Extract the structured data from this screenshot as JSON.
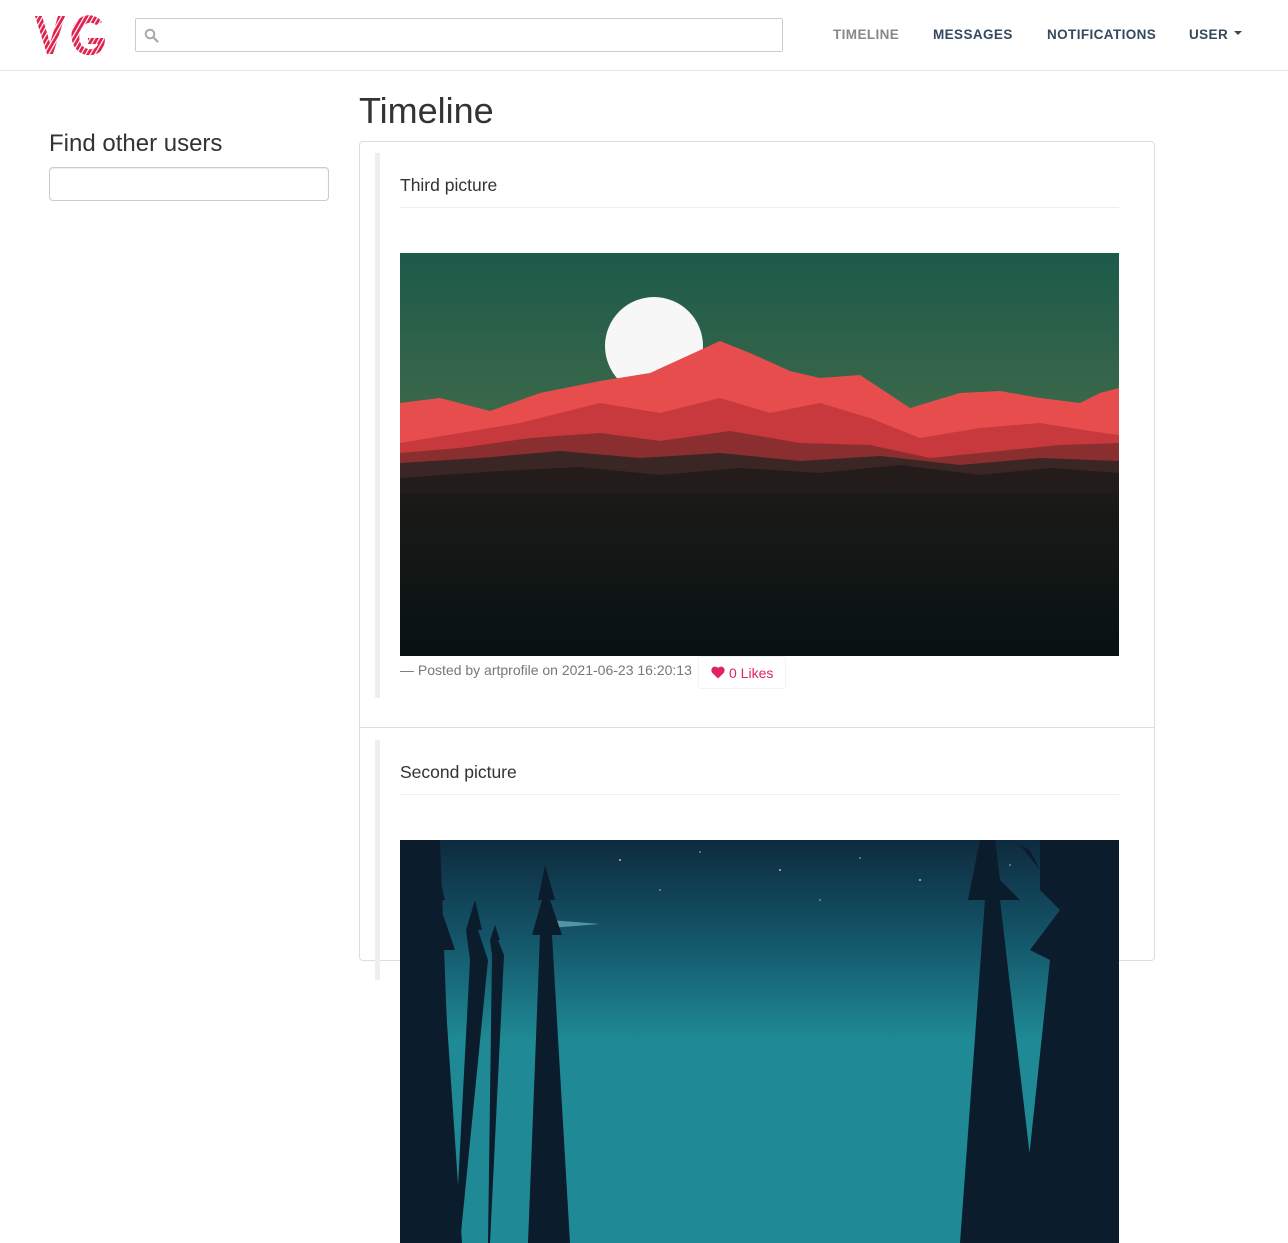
{
  "app": {
    "logo_icon": "vg-logo",
    "logo_text": "VG",
    "brand_color": "#e0214e"
  },
  "navbar": {
    "search": {
      "icon": "search-icon",
      "value": "",
      "placeholder": ""
    },
    "links": {
      "timeline": "TIMELINE",
      "messages": "MESSAGES",
      "notifications": "NOTIFICATIONS",
      "user": "USER"
    },
    "active": "timeline"
  },
  "sidebar": {
    "title": "Find other users",
    "search": {
      "value": "",
      "placeholder": ""
    }
  },
  "main": {
    "title": "Timeline",
    "posts": [
      {
        "title": "Third picture",
        "image": "red-mountains-moon-landscape",
        "meta": "— Posted by artprofile on 2021-06-23 16:20:13",
        "likes_label": "0 Likes",
        "likes_icon": "heart-icon"
      },
      {
        "title": "Second picture",
        "image": "night-forest-landscape"
      }
    ]
  },
  "colors": {
    "nav_text": "#34495e",
    "nav_active": "#888888",
    "like": "#e0245e",
    "meta_text": "#777777"
  }
}
